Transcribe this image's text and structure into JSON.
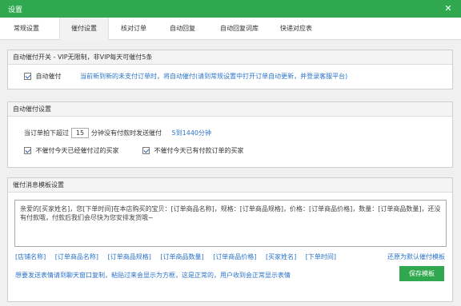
{
  "window": {
    "title": "设置",
    "close_glyph": "✕",
    "close_icon": "close-icon",
    "accent_color": "#2fa84f"
  },
  "tabs": [
    {
      "label": "常规设置",
      "active": false
    },
    {
      "label": "催付设置",
      "active": true
    },
    {
      "label": "核对订单",
      "active": false
    },
    {
      "label": "自动回复",
      "active": false
    },
    {
      "label": "自动回复词库",
      "active": false
    },
    {
      "label": "快递对应表",
      "active": false
    }
  ],
  "auto_switch": {
    "header": "自动催付开关 - VIP无限制，非VIP每天可催付5条",
    "checkbox_label": "自动催付",
    "checked": true,
    "description": "当前新到新的未支付订单时，将自动催付(请到常规设置中打开订单自动更新，并登录客服平台)"
  },
  "auto_settings": {
    "header": "自动催付设置",
    "prefix": "当订单拍下超过",
    "minutes": "15",
    "suffix": "分钟没有付款时发送催付",
    "range_hint": "5到1440分钟",
    "option1": {
      "label": "不催付今天已经催付过的买家",
      "checked": true
    },
    "option2": {
      "label": "不催付今天已有付款订单的买家",
      "checked": true
    }
  },
  "template": {
    "header": "催付消息模板设置",
    "text": "亲爱的[买家姓名]，您[下单时间]在本店购买的宝贝：[订单商品名称]，规格：[订单商品规格]，价格：[订单商品价格]，数量：[订单商品数量]，还没有付款哦，付款后我们会尽快为您安排发货哦~",
    "variables": [
      "[店铺名称]",
      "[订单商品名称]",
      "[订单商品规格]",
      "[订单商品数量]",
      "[订单商品价格]",
      "[买家姓名]",
      "[下单时间]"
    ],
    "restore_label": "还原为默认催付模板",
    "hint": "想要发送表情请到聊天窗口复制，粘贴过来会显示为方框，这是正常的，用户收到会正常显示表情",
    "save_label": "保存模板"
  }
}
